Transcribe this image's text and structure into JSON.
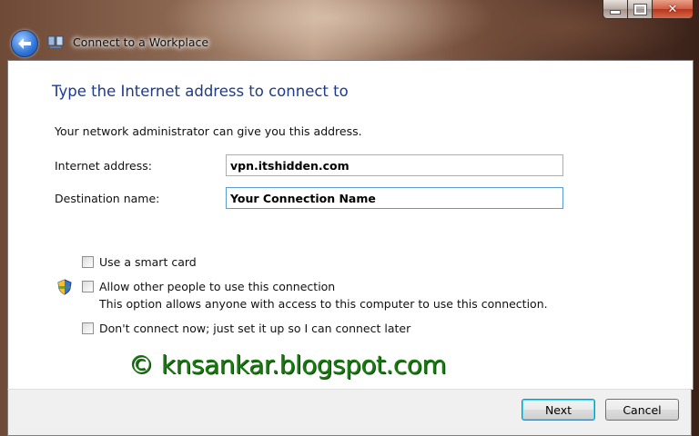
{
  "window": {
    "title": "Connect to a Workplace",
    "controls": {
      "minimize": "minimize",
      "maximize": "maximize",
      "close": "close"
    }
  },
  "page": {
    "heading": "Type the Internet address to connect to",
    "info": "Your network administrator can give you this address."
  },
  "form": {
    "internet_address_label": "Internet address:",
    "internet_address_value": "vpn.itshidden.com",
    "destination_name_label": "Destination name:",
    "destination_name_value": "Your Connection Name"
  },
  "options": {
    "smart_card": {
      "label": "Use a smart card",
      "checked": false
    },
    "allow_others": {
      "label": "Allow other people to use this connection",
      "description": "This option allows anyone with access to this computer to use this connection.",
      "checked": false
    },
    "dont_connect": {
      "label": "Don't connect now; just set it up so I can connect later",
      "checked": false
    }
  },
  "watermark": "© knsankar.blogspot.com",
  "buttons": {
    "next": "Next",
    "cancel": "Cancel"
  },
  "icons": {
    "back": "back-arrow-icon",
    "wizard": "network-connection-icon",
    "uac": "uac-shield-icon"
  },
  "colors": {
    "heading": "#1e3a8a",
    "watermark": "#1a7a12",
    "default_button_border": "#3c7fb1"
  }
}
